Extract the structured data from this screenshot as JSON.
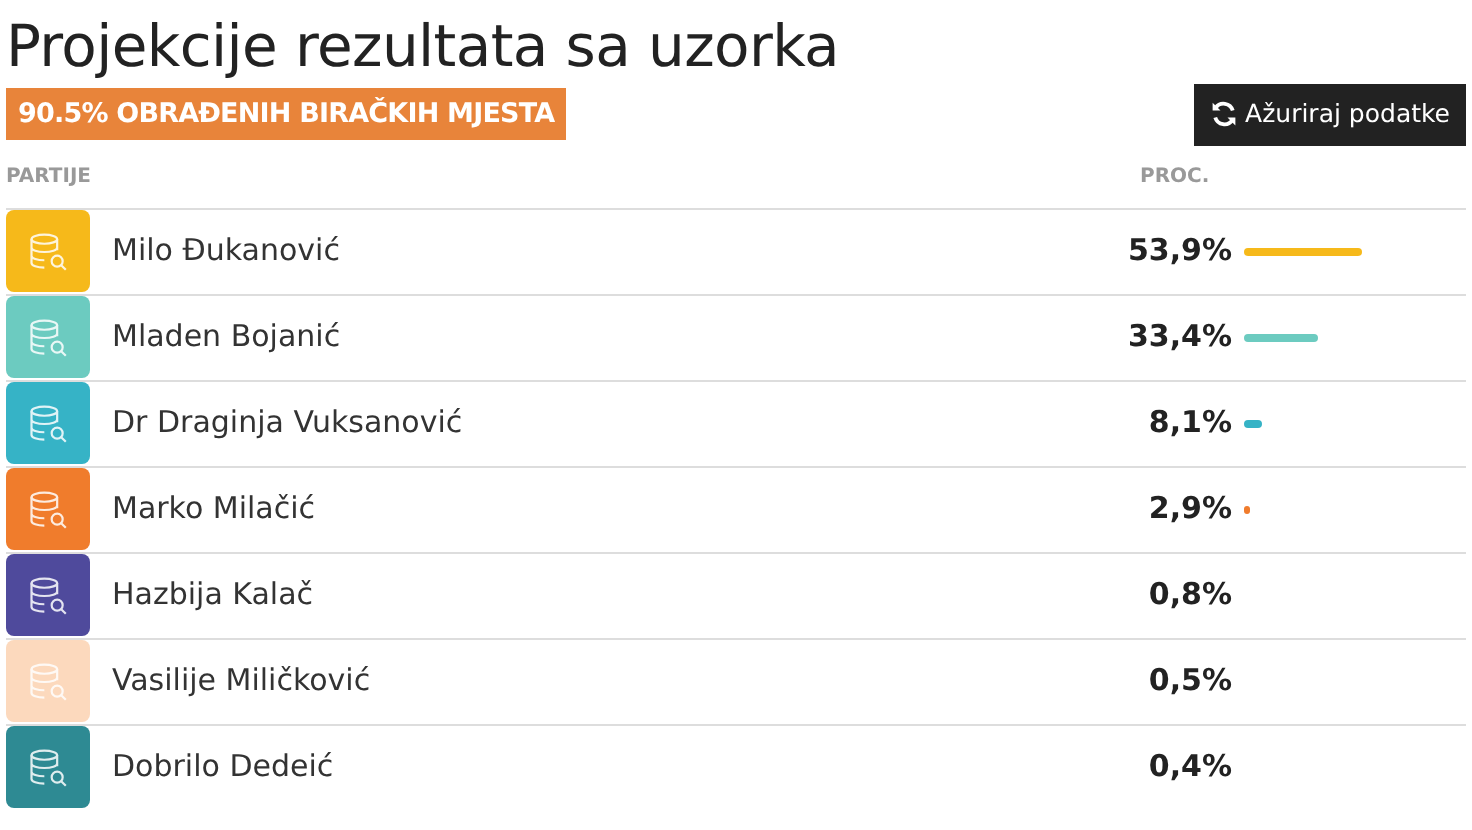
{
  "title": "Projekcije rezultata sa uzorka",
  "badge": "90.5% OBRAĐENIH BIRAČKIH MJESTA",
  "refresh_button": {
    "label": "Ažuriraj podatke"
  },
  "table": {
    "columns": [
      "PARTIJE",
      "PROC."
    ],
    "rows": [
      {
        "name": "Milo Đukanović",
        "percent": "53,9%",
        "color": "#f6b91a"
      },
      {
        "name": "Mladen Bojanić",
        "percent": "33,4%",
        "color": "#6ccbc0"
      },
      {
        "name": "Dr Draginja Vuksanović",
        "percent": "8,1%",
        "color": "#36b3c6"
      },
      {
        "name": "Marko Milačić",
        "percent": "2,9%",
        "color": "#f07c2c"
      },
      {
        "name": "Hazbija Kalač",
        "percent": "0,8%",
        "color": "#4f4a9c"
      },
      {
        "name": "Vasilije Miličković",
        "percent": "0,5%",
        "color": "#fcd9bd"
      },
      {
        "name": "Dobrilo Dedeić",
        "percent": "0,4%",
        "color": "#2e8a93"
      }
    ]
  }
}
